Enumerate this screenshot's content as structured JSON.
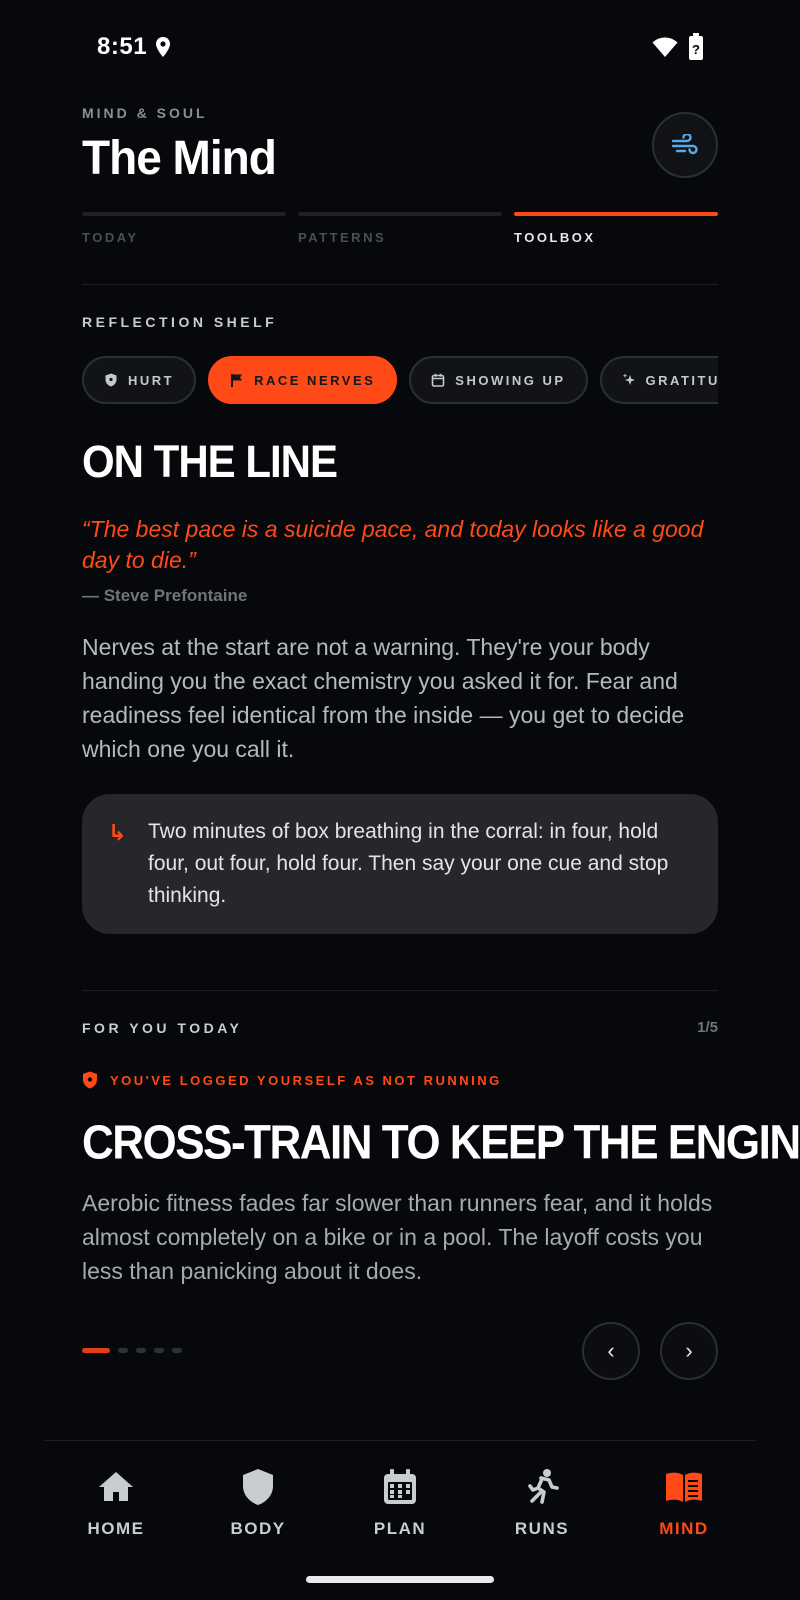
{
  "status": {
    "time": "8:51"
  },
  "header": {
    "eyebrow": "MIND & SOUL",
    "title": "The Mind"
  },
  "tabs": [
    {
      "label": "TODAY",
      "active": false
    },
    {
      "label": "PATTERNS",
      "active": false
    },
    {
      "label": "TOOLBOX",
      "active": true
    }
  ],
  "shelf": {
    "label": "REFLECTION SHELF",
    "chips": [
      {
        "label": "HURT",
        "icon": "shield-icon",
        "active": false
      },
      {
        "label": "RACE NERVES",
        "icon": "flag-icon",
        "active": true
      },
      {
        "label": "SHOWING UP",
        "icon": "calendar-icon",
        "active": false
      },
      {
        "label": "GRATITUDE",
        "icon": "sparkle-icon",
        "active": false
      }
    ]
  },
  "reflection": {
    "title": "ON THE LINE",
    "quote": "“The best pace is a suicide pace, and today looks like a good day to die.”",
    "author": "— Steve Prefontaine",
    "body": "Nerves at the start are not a warning. They're your body handing you the exact chemistry you asked it for. Fear and readiness feel identical from the inside — you get to decide which one you call it.",
    "tip_arrow": "↳",
    "tip": "Two minutes of box breathing in the corral: in four, hold four, out four, hold four. Then say your one cue and stop thinking."
  },
  "for_you": {
    "label": "FOR YOU TODAY",
    "counter": "1/5",
    "flag": "YOU'VE LOGGED YOURSELF AS NOT RUNNING",
    "title": "CROSS-TRAIN TO KEEP THE ENGINE",
    "body": "Aerobic fitness fades far slower than runners fear, and it holds almost completely on a bike or in a pool. The layoff costs you less than panicking about it does.",
    "prev": "‹",
    "next": "›",
    "page_index": 1,
    "page_total": 5
  },
  "bottom_nav": [
    {
      "label": "HOME",
      "icon": "home-icon",
      "active": false
    },
    {
      "label": "BODY",
      "icon": "shield-icon",
      "active": false
    },
    {
      "label": "PLAN",
      "icon": "calendar-icon",
      "active": false
    },
    {
      "label": "RUNS",
      "icon": "runner-icon",
      "active": false
    },
    {
      "label": "MIND",
      "icon": "book-icon",
      "active": true
    }
  ],
  "colors": {
    "accent": "#ff4a17",
    "background": "#07080b",
    "card": "#26272b"
  }
}
